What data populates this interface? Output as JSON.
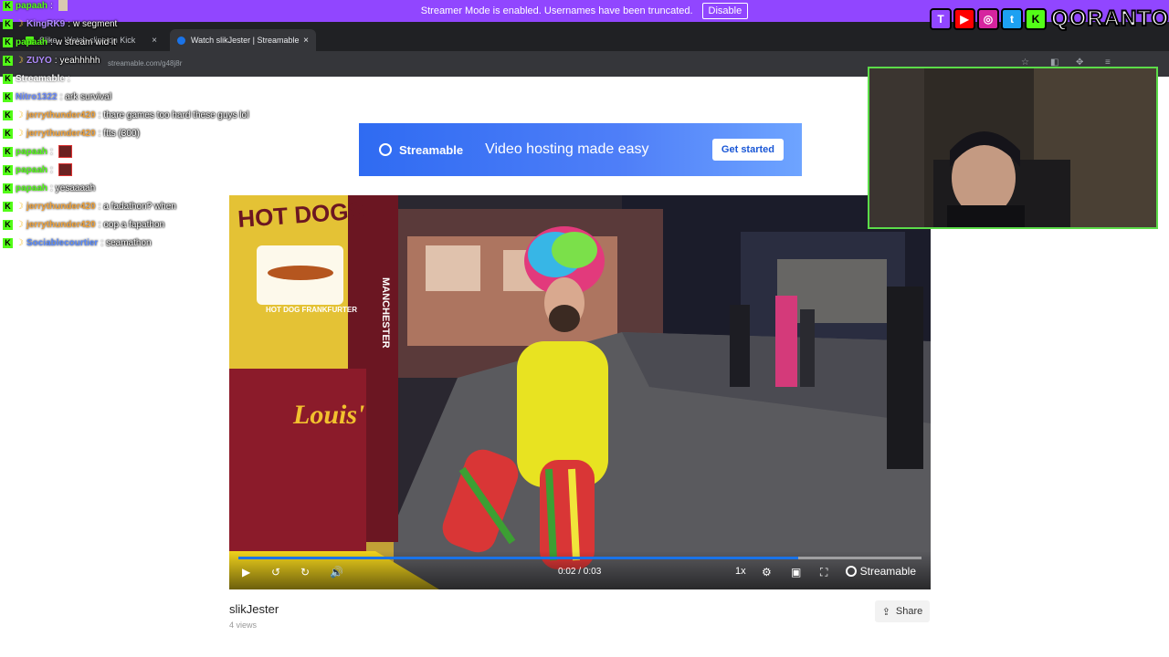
{
  "streamer_bar": {
    "message": "Streamer Mode is enabled. Usernames have been truncated.",
    "button": "Disable"
  },
  "browser": {
    "tabs": [
      {
        "label": "Slike - Watch clips on Kick"
      },
      {
        "label": "Watch slikJester | Streamable"
      }
    ],
    "new_tab": "+",
    "close": "×",
    "url": "streamable.com/g48j8r"
  },
  "banner": {
    "brand": "Streamable",
    "tagline": "Video hosting made easy",
    "cta": "Get started"
  },
  "video": {
    "time": "0:02 / 0:03",
    "progress_fraction": 0.82,
    "speed": "1x",
    "brand": "Streamable",
    "sign_hotdogs": "HOT DOGS",
    "sign_frankfurter": "HOT DOG FRANKFURTER",
    "sign_louis": "Louis'",
    "sign_manchester": "MANCHESTER"
  },
  "page": {
    "title": "slikJester",
    "views": "4 views",
    "share": "Share"
  },
  "chat": [
    {
      "user": "papaah",
      "color": "#53fc18",
      "text": "",
      "emote": "emote2",
      "badge": true,
      "moon": false
    },
    {
      "user": "KingRK9",
      "color": "#b18cff",
      "text": "w segment",
      "emote": "",
      "badge": true,
      "moon": true
    },
    {
      "user": "papaah",
      "color": "#53fc18",
      "text": "w stream wid it",
      "emote": "",
      "badge": true,
      "moon": false
    },
    {
      "user": "ZUYO",
      "color": "#b18cff",
      "text": "yeahhhhh",
      "emote": "",
      "badge": true,
      "moon": true
    },
    {
      "user": "Streamable",
      "color": "#ffffff",
      "text": "",
      "emote": "",
      "badge": true,
      "moon": false
    },
    {
      "user": "Nitro1322",
      "color": "#6c8cff",
      "text": "ark survival",
      "emote": "",
      "badge": true,
      "moon": false
    },
    {
      "user": "jerrythunder420",
      "color": "#f2a33a",
      "text": "thare games too hard these guys lol",
      "emote": "",
      "badge": true,
      "moon": true
    },
    {
      "user": "jerrythunder420",
      "color": "#f2a33a",
      "text": "ftts (300)",
      "emote": "",
      "badge": true,
      "moon": true
    },
    {
      "user": "papaah",
      "color": "#53fc18",
      "text": "",
      "emote": "emote",
      "badge": true,
      "moon": false
    },
    {
      "user": "papaah",
      "color": "#53fc18",
      "text": "",
      "emote": "emote",
      "badge": true,
      "moon": false
    },
    {
      "user": "papaah",
      "color": "#53fc18",
      "text": "yesaaaah",
      "emote": "",
      "badge": true,
      "moon": false
    },
    {
      "user": "jerrythunder420",
      "color": "#f2a33a",
      "text": "a fadathon? when",
      "emote": "",
      "badge": true,
      "moon": true
    },
    {
      "user": "jerrythunder420",
      "color": "#f2a33a",
      "text": "oop a fapathon",
      "emote": "",
      "badge": true,
      "moon": true
    },
    {
      "user": "Sociablecourtier",
      "color": "#5a8bff",
      "text": "seamathon",
      "emote": "",
      "badge": true,
      "moon": true
    }
  ],
  "socials": {
    "icons": [
      "twitch-icon",
      "youtube-icon",
      "instagram-icon",
      "twitter-icon",
      "kick-icon"
    ],
    "glyphs": [
      "T",
      "▶",
      "◎",
      "t",
      "K"
    ],
    "colors": [
      "#9146ff",
      "#ff0000",
      "#d6249f",
      "#1da1f2",
      "#53fc18"
    ],
    "name": "QORANTOS"
  },
  "colors": {
    "accent": "#9146ff",
    "streamable_blue": "#2f6bf2",
    "cam_border": "#5bdc49",
    "kick_green": "#53fc18"
  }
}
